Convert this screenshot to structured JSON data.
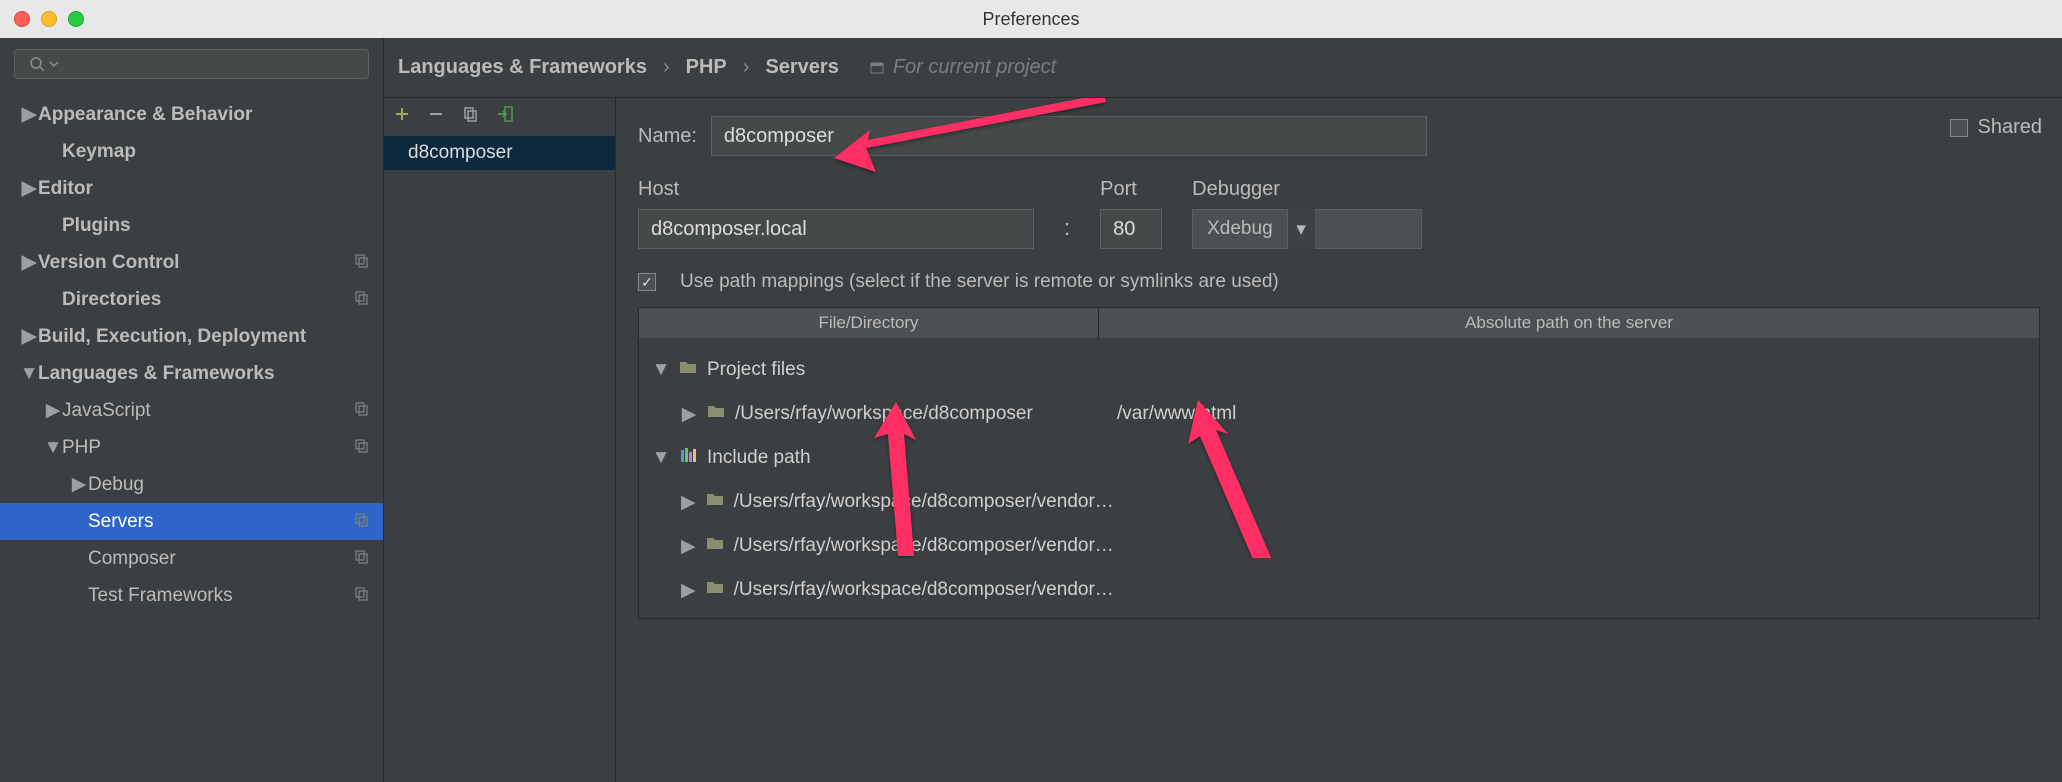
{
  "window": {
    "title": "Preferences"
  },
  "sidebar": {
    "search_placeholder": "",
    "items": [
      {
        "label": "Appearance & Behavior",
        "expandable": true,
        "bold": true
      },
      {
        "label": "Keymap",
        "indent": 1,
        "bold": true
      },
      {
        "label": "Editor",
        "expandable": true,
        "bold": true
      },
      {
        "label": "Plugins",
        "indent": 1,
        "bold": true
      },
      {
        "label": "Version Control",
        "expandable": true,
        "bold": true,
        "copy": true
      },
      {
        "label": "Directories",
        "indent": 1,
        "bold": true,
        "copy": true
      },
      {
        "label": "Build, Execution, Deployment",
        "expandable": true,
        "bold": true
      },
      {
        "label": "Languages & Frameworks",
        "expandable": true,
        "expanded": true,
        "bold": true
      },
      {
        "label": "JavaScript",
        "indent": 1,
        "expandable": true,
        "copy": true
      },
      {
        "label": "PHP",
        "indent": 1,
        "expandable": true,
        "expanded": true,
        "copy": true
      },
      {
        "label": "Debug",
        "indent": 2,
        "expandable": true
      },
      {
        "label": "Servers",
        "indent": 2,
        "selected": true,
        "copy": true
      },
      {
        "label": "Composer",
        "indent": 2,
        "copy": true
      },
      {
        "label": "Test Frameworks",
        "indent": 2,
        "copy": true
      }
    ]
  },
  "breadcrumb": {
    "parts": [
      "Languages & Frameworks",
      "PHP",
      "Servers"
    ],
    "scope": "For current project"
  },
  "serverlist": {
    "items": [
      "d8composer"
    ]
  },
  "form": {
    "name_label": "Name:",
    "name_value": "d8composer",
    "shared_label": "Shared",
    "host_label": "Host",
    "host_value": "d8composer.local",
    "port_label": "Port",
    "port_value": "80",
    "debugger_label": "Debugger",
    "debugger_value": "Xdebug",
    "pathmap_check": "Use path mappings (select if the server is remote or symlinks are used)",
    "headers": {
      "file": "File/Directory",
      "abs": "Absolute path on the server"
    },
    "rows": [
      {
        "kind": "group",
        "label": "Project files",
        "expanded": true
      },
      {
        "kind": "leaf",
        "path": "/Users/rfay/workspace/d8composer",
        "abs": "/var/www/html",
        "indent": 1
      },
      {
        "kind": "group",
        "label": "Include path",
        "expanded": true,
        "icon": "bars"
      },
      {
        "kind": "leaf",
        "path": "/Users/rfay/workspace/d8composer/vendor",
        "trunc": true,
        "indent": 1
      },
      {
        "kind": "leaf",
        "path": "/Users/rfay/workspace/d8composer/vendor",
        "trunc": true,
        "indent": 1
      },
      {
        "kind": "leaf",
        "path": "/Users/rfay/workspace/d8composer/vendor",
        "trunc": true,
        "indent": 1
      }
    ]
  },
  "annotations": {
    "color": "#ff2e63"
  }
}
